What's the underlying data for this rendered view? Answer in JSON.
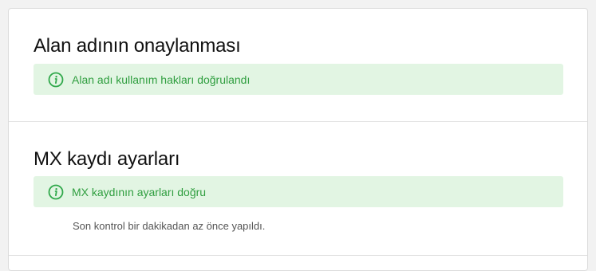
{
  "domain_verification": {
    "title": "Alan adının onaylanması",
    "notice": "Alan adı kullanım hakları doğrulandı"
  },
  "mx_settings": {
    "title": "MX kaydı ayarları",
    "notice": "MX kaydının ayarları doğru",
    "last_check": "Son kontrol bir dakikadan az önce yapıldı."
  },
  "colors": {
    "notice_bg": "#e2f5e3",
    "notice_text": "#2f9e3f",
    "icon": "#2fa84a"
  },
  "icons": {
    "notice_icon": "info-icon"
  }
}
